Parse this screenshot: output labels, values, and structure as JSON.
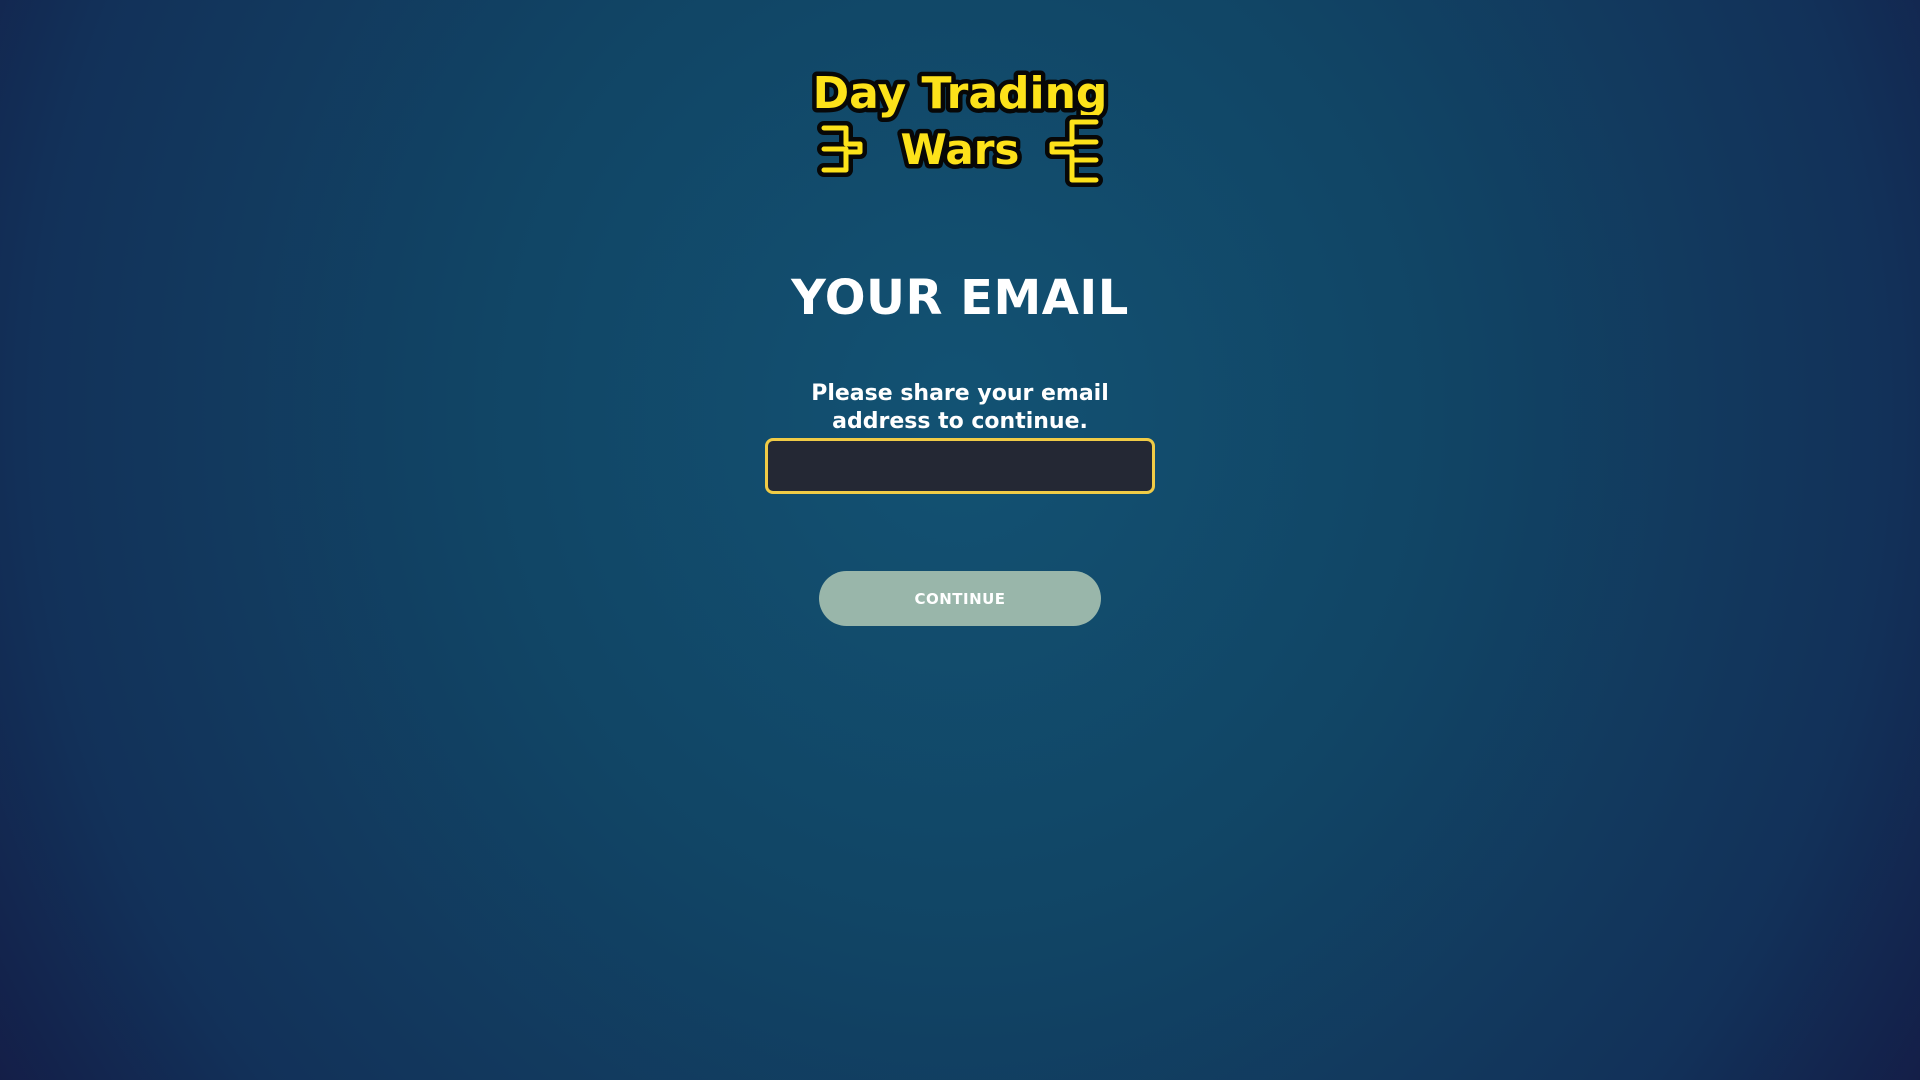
{
  "logo": {
    "line1": "Day Trading",
    "line2": "Wars",
    "color": "#fde21a",
    "outline_color": "#070707"
  },
  "heading": "YOUR EMAIL",
  "prompt": "Please share your email address to continue.",
  "email_input": {
    "value": "",
    "placeholder": "",
    "border_color": "#f0cb46"
  },
  "continue_button": {
    "label": "CONTINUE",
    "color": "#99b6aa"
  }
}
